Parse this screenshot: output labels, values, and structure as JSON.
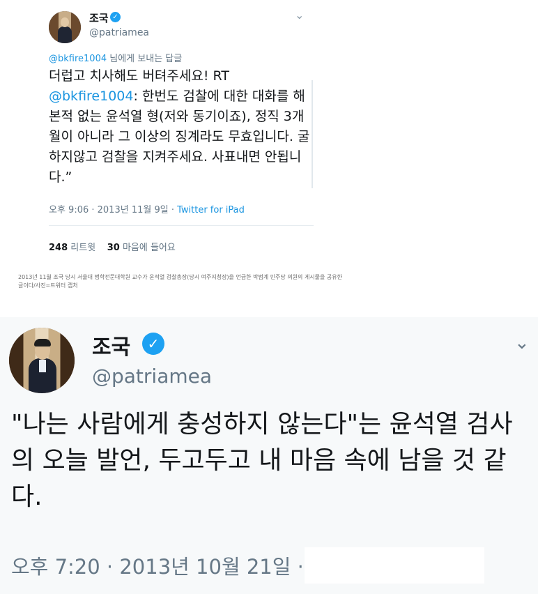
{
  "tweet1": {
    "name": "조국",
    "handle": "@patriamea",
    "reply_prefix_mention": "@bkfire1004",
    "reply_suffix": "님에게 보내는 답글",
    "text_line1": "더럽고 치사해도 버텨주세요! RT",
    "text_mention": "@bkfire1004",
    "text_rest": ": 한번도 검찰에 대한 대화를 해본적 없는 윤석열 형(저와 동기이죠), 정직 3개월이 아니라 그 이상의 징계라도 무효입니다. 굴하지않고 검찰을 지켜주세요. 사표내면 안됩니다.”",
    "time": "오후 9:06 · 2013년 11월 9일 · ",
    "source": "Twitter for iPad",
    "retweets_count": "248",
    "retweets_label": "리트윗",
    "likes_count": "30",
    "likes_label": "마음에 들어요"
  },
  "caption": "2013년 11월 조국 당시 서울대 법학전문대학원 교수가 윤석열 검찰총장(당시 여주지청장)을 언급한 박범계 민주당 의원의 게시물을 공유한 글이다/사진=트위터 캡처",
  "tweet2": {
    "name": "조국",
    "handle": "@patriamea",
    "text": "\"나는 사람에게 충성하지 않는다\"는 윤석열 검사의 오늘 발언, 두고두고 내 마음 속에 남을 것 같다.",
    "time": "오후 7:20 · 2013년 10월 21일 ·"
  },
  "icons": {
    "verified": "verified-badge-icon",
    "more": "chevron-down-icon"
  },
  "colors": {
    "link": "#1b95e0",
    "verified": "#1da1f2",
    "secondary": "#657786"
  }
}
